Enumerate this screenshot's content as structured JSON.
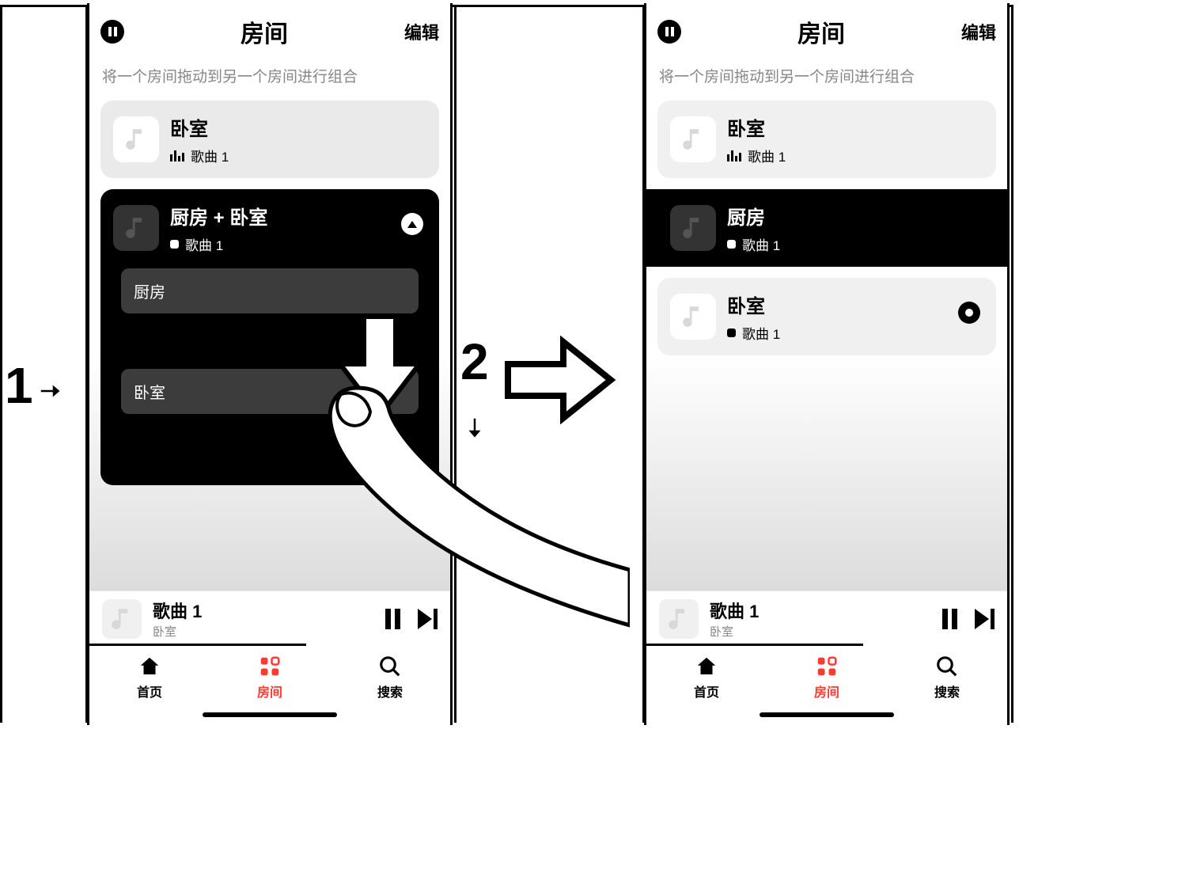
{
  "steps": {
    "one": "1",
    "two": "2"
  },
  "header": {
    "title": "房间",
    "edit": "编辑"
  },
  "hint": "将一个房间拖动到另一个房间进行组合",
  "song": "歌曲 1",
  "rooms": {
    "bedroom": "卧室",
    "kitchen": "厨房",
    "combo": "厨房 + 卧室"
  },
  "player": {
    "title": "歌曲 1",
    "room": "卧室"
  },
  "tabs": {
    "home": "首页",
    "rooms": "房间",
    "search": "搜索"
  }
}
